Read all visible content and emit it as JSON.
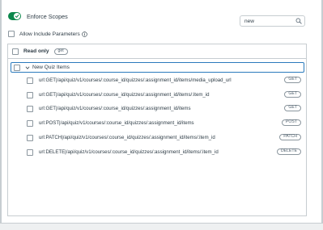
{
  "enforce_scopes": {
    "label": "Enforce Scopes",
    "enabled": true
  },
  "search": {
    "value": "new"
  },
  "allow_include": {
    "label": "Allow Include Parameters"
  },
  "read_only": {
    "label": "Read only",
    "badge": "get"
  },
  "group": {
    "title": "New Quiz Items"
  },
  "endpoints": [
    {
      "path": "url:GET|/api/quiz/v1/courses/:course_id/quizzes/:assignment_id/items/media_upload_url",
      "method": "GET"
    },
    {
      "path": "url:GET|/api/quiz/v1/courses/:course_id/quizzes/:assignment_id/items/:item_id",
      "method": "GET"
    },
    {
      "path": "url:GET|/api/quiz/v1/courses/:course_id/quizzes/:assignment_id/items",
      "method": "GET"
    },
    {
      "path": "url:POST|/api/quiz/v1/courses/:course_id/quizzes/:assignment_id/items",
      "method": "POST"
    },
    {
      "path": "url:PATCH|/api/quiz/v1/courses/:course_id/quizzes/:assignment_id/items/:item_id",
      "method": "PATCH"
    },
    {
      "path": "url:DELETE|/api/quiz/v1/courses/:course_id/quizzes/:assignment_id/items/:item_id",
      "method": "DELETE"
    }
  ],
  "colors": {
    "toggle_on": "#0b874b",
    "focus_border": "#2b7abc",
    "text": "#2d3b45"
  }
}
